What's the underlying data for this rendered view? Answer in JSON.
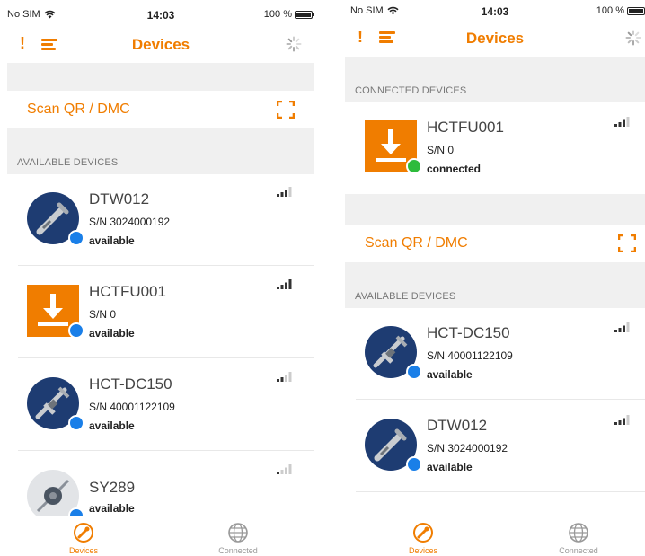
{
  "colors": {
    "accent": "#f07d00",
    "status_blue": "#1a7fe8",
    "status_green": "#2dbb3c"
  },
  "left": {
    "status": {
      "carrier": "No SIM",
      "time": "14:03",
      "battery": "100 %"
    },
    "nav": {
      "alert": "!",
      "title": "Devices"
    },
    "scan_label": "Scan QR / DMC",
    "available_header": "AVAILABLE DEVICES",
    "devices": [
      {
        "name": "DTW012",
        "sn": "S/N 3024000192",
        "status": "available",
        "icon": "torque-wrench-icon"
      },
      {
        "name": "HCTFU001",
        "sn": "S/N 0",
        "status": "available",
        "icon": "download-box-icon"
      },
      {
        "name": "HCT-DC150",
        "sn": "S/N 40001122109",
        "status": "available",
        "icon": "caliper-icon"
      },
      {
        "name": "SY289",
        "status": "available",
        "icon": "probe-icon"
      }
    ],
    "tabs": [
      {
        "label": "Devices",
        "icon": "devices-icon"
      },
      {
        "label": "Connected",
        "icon": "globe-icon"
      }
    ]
  },
  "right": {
    "status": {
      "carrier": "No SIM",
      "time": "14:03",
      "battery": "100 %"
    },
    "nav": {
      "alert": "!",
      "title": "Devices"
    },
    "connected_header": "CONNECTED DEVICES",
    "connected_device": {
      "name": "HCTFU001",
      "sn": "S/N 0",
      "status": "connected",
      "icon": "download-box-icon"
    },
    "scan_label": "Scan QR / DMC",
    "available_header": "AVAILABLE DEVICES",
    "devices": [
      {
        "name": "HCT-DC150",
        "sn": "S/N 40001122109",
        "status": "available",
        "icon": "caliper-icon"
      },
      {
        "name": "DTW012",
        "sn": "S/N 3024000192",
        "status": "available",
        "icon": "torque-wrench-icon"
      }
    ],
    "tabs": [
      {
        "label": "Devices",
        "icon": "devices-icon"
      },
      {
        "label": "Connected",
        "icon": "globe-icon"
      }
    ]
  }
}
